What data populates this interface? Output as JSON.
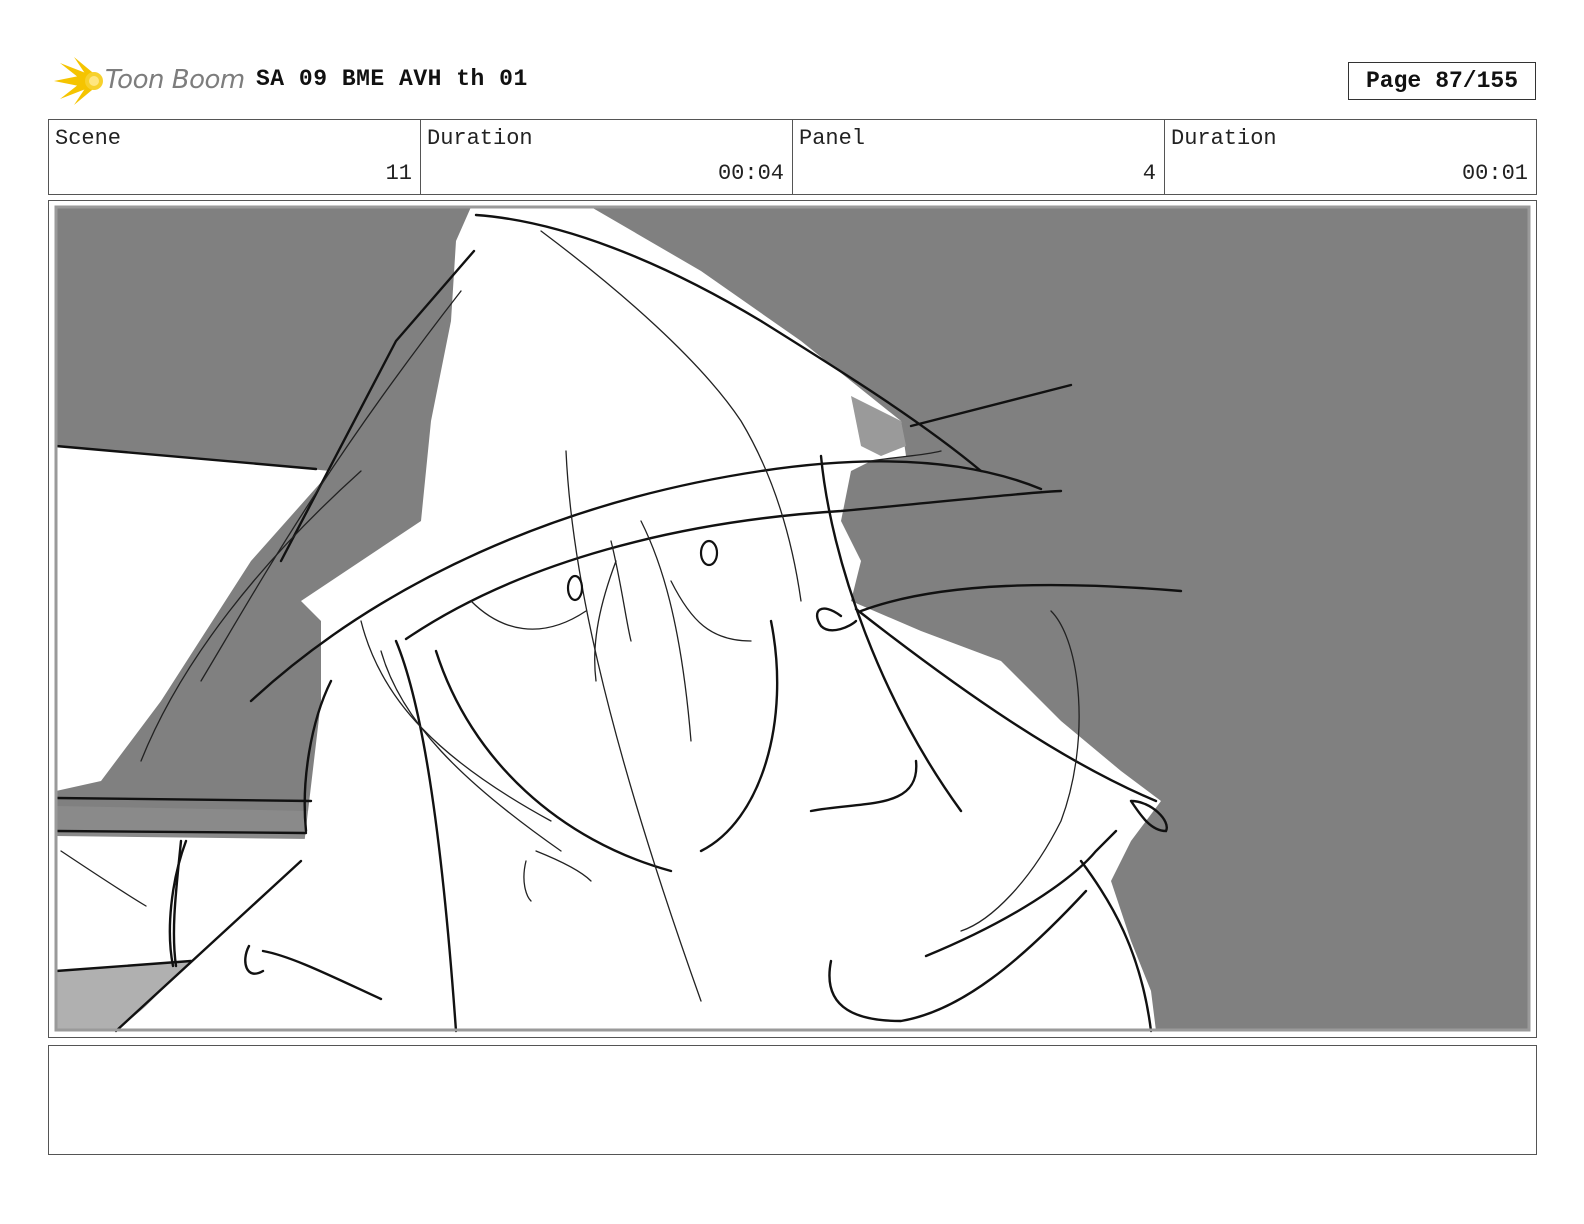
{
  "header": {
    "logo_text": "Toon Boom",
    "title": "SA 09 BME AVH th 01",
    "page_label": "Page",
    "page_value": "87/155"
  },
  "info": {
    "scene_label": "Scene",
    "scene_value": "11",
    "scene_duration_label": "Duration",
    "scene_duration_value": "00:04",
    "panel_label": "Panel",
    "panel_value": "4",
    "panel_duration_label": "Duration",
    "panel_duration_value": "00:01"
  },
  "notes": {
    "text": ""
  },
  "colors": {
    "background_gray": "#808080",
    "logo_yellow": "#f5c400",
    "logo_text": "#7d7d7d"
  }
}
